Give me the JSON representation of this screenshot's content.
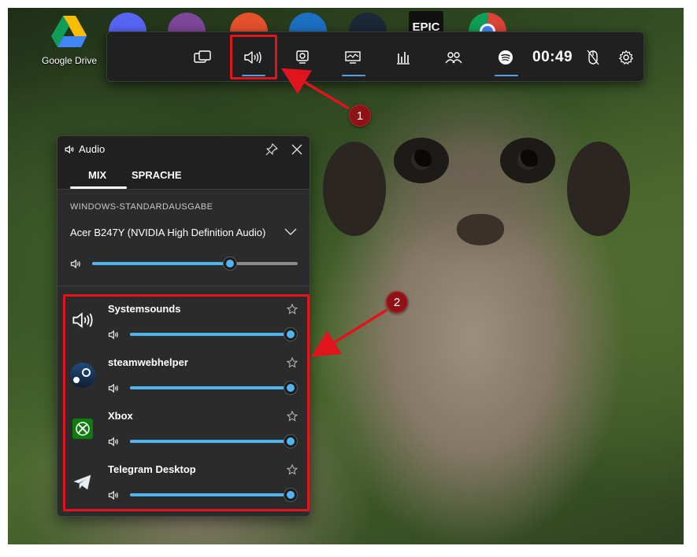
{
  "desktop": {
    "icons": [
      {
        "name": "Google Drive",
        "label": "Google Drive"
      },
      {
        "name": "Discord"
      },
      {
        "name": "Tor Browser"
      },
      {
        "name": "EA"
      },
      {
        "name": "Battle.net"
      },
      {
        "name": "Steam"
      },
      {
        "name": "Epic Games",
        "text": "EPIC"
      },
      {
        "name": "Google Chrome"
      }
    ]
  },
  "gamebar": {
    "buttons": [
      {
        "icon": "widget-menu-icon"
      },
      {
        "icon": "audio-icon",
        "active": true
      },
      {
        "icon": "capture-icon"
      },
      {
        "icon": "performance-icon",
        "active": true
      },
      {
        "icon": "resources-icon"
      },
      {
        "icon": "xbox-social-icon"
      },
      {
        "icon": "spotify-icon",
        "active": true
      }
    ],
    "clock": "00:49",
    "mouse_icon": "mouse-lock-icon",
    "settings_icon": "gear-icon"
  },
  "audio_panel": {
    "title": "Audio",
    "tabs": [
      {
        "label": "MIX",
        "active": true
      },
      {
        "label": "SPRACHE",
        "active": false
      }
    ],
    "section_label": "WINDOWS-STANDARDAUSGABE",
    "output_device": "Acer B247Y (NVIDIA High Definition Audio)",
    "master_volume": 0.67,
    "apps": [
      {
        "name": "Systemsounds",
        "icon": "speaker-icon",
        "volume": 1.0
      },
      {
        "name": "steamwebhelper",
        "icon": "steam-icon",
        "volume": 1.0
      },
      {
        "name": "Xbox",
        "icon": "xbox-icon",
        "volume": 1.0
      },
      {
        "name": "Telegram Desktop",
        "icon": "telegram-icon",
        "volume": 1.0
      }
    ]
  },
  "annotations": [
    {
      "number": "1"
    },
    {
      "number": "2"
    }
  ],
  "colors": {
    "accent": "#4fb5f0",
    "annotation_red": "#e0141c",
    "badge": "#8e1216",
    "panel_bg": "#2b2b2b",
    "bar_bg": "#202020"
  }
}
